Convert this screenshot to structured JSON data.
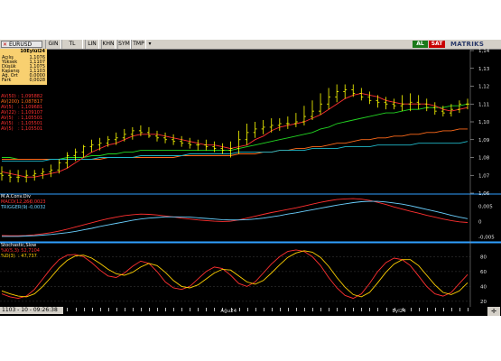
{
  "toolbar": {
    "symbol": "EURUSD",
    "close_glyph": "✕",
    "buttons": [
      "GIN",
      "TL",
      "LIN",
      "KHN",
      "SYM",
      "TMP"
    ],
    "dropdown_glyph": "▾",
    "al_label": "AL",
    "sat_label": "SAT",
    "brand": "MATRIKS",
    "colors": {
      "al": "#1a7a1a",
      "sat": "#c80000"
    }
  },
  "stats": {
    "header": "10Eylül24",
    "rows": [
      {
        "label": "Açılış",
        "value": "1,1076"
      },
      {
        "label": "Yüksek",
        "value": "1,1107"
      },
      {
        "label": "Düşük",
        "value": "1,1075"
      },
      {
        "label": "Kapanış",
        "value": "1,1103"
      },
      {
        "label": "Ağ. Ort",
        "value": "0,0000"
      },
      {
        "label": "Fark",
        "value": "0,0028"
      }
    ]
  },
  "legends": {
    "price": [
      {
        "name": "AV(50)",
        "value": ": 1,095882",
        "color": "#ff3030"
      },
      {
        "name": "AV(200)",
        "value": ": 1,087817",
        "color": "#ff6a1a"
      },
      {
        "name": "AV(5)",
        "value": ": 1,109681",
        "color": "#ff3030"
      },
      {
        "name": "AV(22)",
        "value": ": 1,109107",
        "color": "#ff3030"
      },
      {
        "name": "AV(5)",
        "value": ": 1,105501",
        "color": "#ff3030"
      },
      {
        "name": "AV(5)",
        "value": ": 1,105501",
        "color": "#ff3030"
      },
      {
        "name": "AV(5)",
        "value": ": 1,105501",
        "color": "#ff3030"
      }
    ],
    "macd_title": "M.A.Conv.Div",
    "macd": [
      {
        "name": "MACD(12,26)",
        "value": ": -0,0023",
        "color": "#ff3030"
      },
      {
        "name": "TRIGGER(9)",
        "value": ": -0,0032",
        "color": "#6ad0ff"
      }
    ],
    "stoch_title": "Stochastic,Slow",
    "stoch": [
      {
        "name": "%K(5,3)",
        "value": ": 52,7104",
        "color": "#ff3030"
      },
      {
        "name": "%D(3)",
        "value": ": 47,737",
        "color": "#ffd000"
      }
    ]
  },
  "price_axis": [
    "1,14",
    "1,13",
    "1,12",
    "1,11",
    "1,10",
    "1,09",
    "1,08",
    "1,07",
    "1,06"
  ],
  "macd_axis": [
    "0,005",
    "0",
    "-0,005"
  ],
  "stoch_axis": [
    "80",
    "60",
    "40",
    "20"
  ],
  "dates": [
    "Ağu24",
    "Eyl24"
  ],
  "status": {
    "clock": "1103 - 10 - 09:26:38"
  },
  "colors": {
    "background": "#000000",
    "candle": "#ffff00",
    "ma_green": "#22d422",
    "ma_orange": "#ff6a1a",
    "ma_cyan": "#20b8c8",
    "ma_red": "#ff3030",
    "divider": "#30a0ff"
  },
  "chart_data": [
    {
      "type": "line",
      "title": "EURUSD",
      "ylim": [
        1.06,
        1.14
      ],
      "open": [
        1.071,
        1.07,
        1.069,
        1.069,
        1.07,
        1.071,
        1.072,
        1.073,
        1.077,
        1.081,
        1.083,
        1.086,
        1.087,
        1.088,
        1.09,
        1.091,
        1.093,
        1.095,
        1.094,
        1.092,
        1.091,
        1.09,
        1.089,
        1.088,
        1.087,
        1.087,
        1.086,
        1.085,
        1.084,
        1.085,
        1.09,
        1.094,
        1.096,
        1.097,
        1.098,
        1.099,
        1.099,
        1.1,
        1.103,
        1.106,
        1.11,
        1.114,
        1.117,
        1.118,
        1.116,
        1.114,
        1.112,
        1.111,
        1.11,
        1.109,
        1.11,
        1.111,
        1.11,
        1.108,
        1.106,
        1.105,
        1.107,
        1.11
      ],
      "high": [
        1.075,
        1.073,
        1.073,
        1.073,
        1.073,
        1.074,
        1.076,
        1.079,
        1.083,
        1.085,
        1.087,
        1.09,
        1.091,
        1.092,
        1.094,
        1.096,
        1.097,
        1.098,
        1.097,
        1.095,
        1.094,
        1.093,
        1.092,
        1.091,
        1.09,
        1.09,
        1.089,
        1.088,
        1.089,
        1.095,
        1.099,
        1.1,
        1.101,
        1.102,
        1.102,
        1.103,
        1.105,
        1.109,
        1.112,
        1.116,
        1.119,
        1.121,
        1.121,
        1.121,
        1.119,
        1.117,
        1.115,
        1.114,
        1.113,
        1.115,
        1.116,
        1.115,
        1.113,
        1.111,
        1.109,
        1.11,
        1.112,
        1.113
      ],
      "low": [
        1.067,
        1.066,
        1.066,
        1.066,
        1.067,
        1.068,
        1.069,
        1.071,
        1.074,
        1.078,
        1.08,
        1.083,
        1.084,
        1.086,
        1.087,
        1.089,
        1.09,
        1.092,
        1.091,
        1.089,
        1.088,
        1.087,
        1.086,
        1.085,
        1.084,
        1.084,
        1.083,
        1.082,
        1.08,
        1.082,
        1.087,
        1.091,
        1.093,
        1.094,
        1.095,
        1.096,
        1.097,
        1.098,
        1.101,
        1.104,
        1.107,
        1.111,
        1.113,
        1.114,
        1.112,
        1.11,
        1.108,
        1.107,
        1.107,
        1.106,
        1.106,
        1.107,
        1.106,
        1.104,
        1.103,
        1.103,
        1.105,
        1.107
      ],
      "close": [
        1.07,
        1.069,
        1.069,
        1.07,
        1.071,
        1.072,
        1.073,
        1.077,
        1.081,
        1.083,
        1.086,
        1.087,
        1.088,
        1.09,
        1.091,
        1.093,
        1.095,
        1.094,
        1.092,
        1.091,
        1.09,
        1.089,
        1.088,
        1.087,
        1.087,
        1.086,
        1.085,
        1.084,
        1.085,
        1.09,
        1.094,
        1.096,
        1.097,
        1.098,
        1.099,
        1.099,
        1.1,
        1.103,
        1.106,
        1.11,
        1.114,
        1.117,
        1.118,
        1.116,
        1.114,
        1.112,
        1.111,
        1.11,
        1.109,
        1.11,
        1.111,
        1.11,
        1.108,
        1.106,
        1.105,
        1.107,
        1.11,
        1.11
      ],
      "series": [
        {
          "name": "AV(50)",
          "color": "#22d422",
          "values": [
            1.08,
            1.08,
            1.079,
            1.079,
            1.079,
            1.079,
            1.079,
            1.079,
            1.08,
            1.08,
            1.08,
            1.081,
            1.081,
            1.082,
            1.082,
            1.083,
            1.083,
            1.084,
            1.084,
            1.084,
            1.084,
            1.084,
            1.084,
            1.084,
            1.084,
            1.084,
            1.084,
            1.084,
            1.084,
            1.085,
            1.086,
            1.087,
            1.088,
            1.089,
            1.09,
            1.091,
            1.092,
            1.093,
            1.094,
            1.096,
            1.097,
            1.099,
            1.1,
            1.101,
            1.102,
            1.103,
            1.104,
            1.105,
            1.105,
            1.106,
            1.107,
            1.107,
            1.108,
            1.108,
            1.108,
            1.109,
            1.109,
            1.11
          ]
        },
        {
          "name": "AV(200)",
          "color": "#ff6a1a",
          "values": [
            1.079,
            1.079,
            1.079,
            1.079,
            1.079,
            1.079,
            1.079,
            1.079,
            1.079,
            1.079,
            1.079,
            1.079,
            1.079,
            1.08,
            1.08,
            1.08,
            1.08,
            1.08,
            1.08,
            1.08,
            1.08,
            1.08,
            1.081,
            1.081,
            1.081,
            1.081,
            1.081,
            1.081,
            1.081,
            1.082,
            1.082,
            1.082,
            1.083,
            1.083,
            1.084,
            1.084,
            1.085,
            1.085,
            1.086,
            1.086,
            1.087,
            1.088,
            1.088,
            1.089,
            1.09,
            1.09,
            1.091,
            1.091,
            1.092,
            1.092,
            1.093,
            1.093,
            1.094,
            1.094,
            1.095,
            1.095,
            1.096,
            1.096
          ]
        },
        {
          "name": "AV(22)",
          "color": "#20b8c8",
          "values": [
            1.078,
            1.078,
            1.078,
            1.078,
            1.078,
            1.078,
            1.079,
            1.079,
            1.079,
            1.079,
            1.079,
            1.079,
            1.08,
            1.08,
            1.08,
            1.08,
            1.08,
            1.081,
            1.081,
            1.081,
            1.081,
            1.081,
            1.081,
            1.082,
            1.082,
            1.082,
            1.082,
            1.082,
            1.082,
            1.083,
            1.083,
            1.083,
            1.083,
            1.083,
            1.084,
            1.084,
            1.084,
            1.084,
            1.085,
            1.085,
            1.085,
            1.085,
            1.086,
            1.086,
            1.086,
            1.086,
            1.087,
            1.087,
            1.087,
            1.087,
            1.087,
            1.088,
            1.088,
            1.088,
            1.088,
            1.088,
            1.088,
            1.089
          ]
        },
        {
          "name": "AV(5)",
          "color": "#ff3030",
          "values": [
            1.072,
            1.071,
            1.07,
            1.069,
            1.069,
            1.07,
            1.071,
            1.072,
            1.074,
            1.077,
            1.08,
            1.083,
            1.085,
            1.087,
            1.088,
            1.09,
            1.092,
            1.093,
            1.093,
            1.093,
            1.092,
            1.091,
            1.09,
            1.089,
            1.088,
            1.087,
            1.087,
            1.086,
            1.085,
            1.086,
            1.087,
            1.09,
            1.092,
            1.095,
            1.097,
            1.098,
            1.099,
            1.1,
            1.102,
            1.104,
            1.107,
            1.11,
            1.113,
            1.115,
            1.116,
            1.115,
            1.114,
            1.112,
            1.111,
            1.11,
            1.11,
            1.11,
            1.11,
            1.109,
            1.107,
            1.106,
            1.107,
            1.108
          ]
        }
      ]
    },
    {
      "type": "line",
      "title": "M.A.Conv.Div",
      "ylim": [
        -0.006,
        0.008
      ],
      "series": [
        {
          "name": "MACD(12,26)",
          "color": "#ff3030",
          "values": [
            -0.0045,
            -0.0046,
            -0.0046,
            -0.0045,
            -0.0043,
            -0.004,
            -0.0036,
            -0.0031,
            -0.0025,
            -0.0018,
            -0.0011,
            -0.0004,
            0.0003,
            0.0009,
            0.0014,
            0.0019,
            0.0022,
            0.0024,
            0.0023,
            0.0021,
            0.0018,
            0.0015,
            0.0011,
            0.0008,
            0.0005,
            0.0003,
            0.0001,
            0.0,
            0.0001,
            0.0005,
            0.0011,
            0.0017,
            0.0023,
            0.0029,
            0.0034,
            0.0039,
            0.0044,
            0.005,
            0.0056,
            0.0062,
            0.0067,
            0.0071,
            0.0073,
            0.0074,
            0.0072,
            0.0068,
            0.0062,
            0.0055,
            0.0047,
            0.004,
            0.0033,
            0.0027,
            0.002,
            0.0014,
            0.0008,
            0.0003,
            -0.0001,
            -0.0003
          ]
        },
        {
          "name": "TRIGGER(9)",
          "color": "#6ad0ff",
          "values": [
            -0.0048,
            -0.0048,
            -0.0048,
            -0.0047,
            -0.0046,
            -0.0044,
            -0.0042,
            -0.0039,
            -0.0036,
            -0.0032,
            -0.0027,
            -0.0022,
            -0.0016,
            -0.0011,
            -0.0006,
            -0.0001,
            0.0004,
            0.0008,
            0.0011,
            0.0013,
            0.0015,
            0.0015,
            0.0015,
            0.0014,
            0.0012,
            0.001,
            0.0008,
            0.0006,
            0.0005,
            0.0005,
            0.0006,
            0.0008,
            0.0011,
            0.0015,
            0.0019,
            0.0024,
            0.0028,
            0.0033,
            0.0038,
            0.0043,
            0.0048,
            0.0053,
            0.0057,
            0.0061,
            0.0064,
            0.0065,
            0.0065,
            0.0063,
            0.006,
            0.0056,
            0.0051,
            0.0045,
            0.0039,
            0.0033,
            0.0027,
            0.002,
            0.0014,
            0.0009
          ]
        }
      ]
    },
    {
      "type": "line",
      "title": "Stochastic,Slow",
      "ylim": [
        15,
        95
      ],
      "series": [
        {
          "name": "%K(5,3)",
          "color": "#ff3030",
          "values": [
            30,
            26,
            24,
            27,
            36,
            50,
            64,
            76,
            82,
            83,
            80,
            72,
            62,
            54,
            52,
            58,
            67,
            74,
            71,
            60,
            46,
            38,
            36,
            40,
            50,
            60,
            66,
            64,
            55,
            44,
            40,
            46,
            58,
            70,
            80,
            87,
            89,
            87,
            80,
            68,
            52,
            38,
            28,
            24,
            30,
            44,
            60,
            72,
            78,
            76,
            68,
            54,
            40,
            30,
            27,
            32,
            44,
            56
          ]
        },
        {
          "name": "%D(3)",
          "color": "#ffd000",
          "values": [
            34,
            30,
            27,
            26,
            30,
            40,
            52,
            65,
            75,
            81,
            82,
            78,
            71,
            63,
            57,
            55,
            59,
            66,
            71,
            68,
            59,
            48,
            40,
            38,
            42,
            50,
            58,
            63,
            62,
            54,
            46,
            43,
            48,
            58,
            69,
            79,
            85,
            88,
            86,
            79,
            67,
            52,
            39,
            29,
            26,
            32,
            45,
            59,
            70,
            76,
            76,
            68,
            55,
            42,
            32,
            29,
            34,
            45
          ]
        }
      ]
    }
  ]
}
